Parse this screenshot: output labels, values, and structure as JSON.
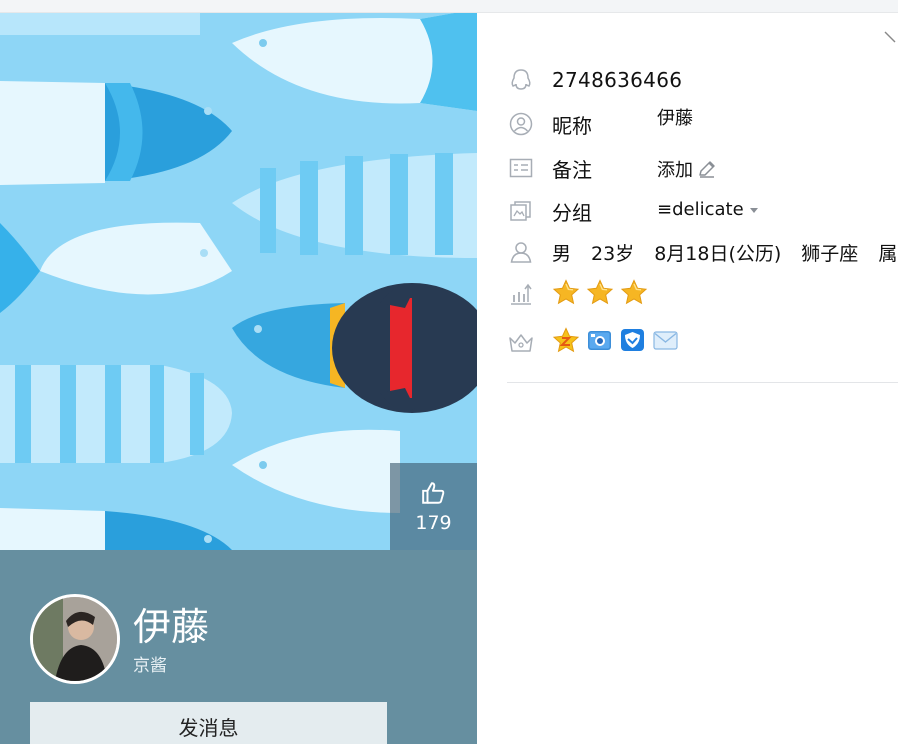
{
  "profile": {
    "like_count": "179",
    "display_name": "伊藤",
    "sub_name": "京酱",
    "send_message_label": "发消息"
  },
  "details": {
    "qq_number": "2748636466",
    "nickname_label": "昵称",
    "nickname_value": "伊藤",
    "remark_label": "备注",
    "remark_action": "添加",
    "group_label": "分组",
    "group_value": "≡delicate",
    "gender": "男",
    "age": "23岁",
    "birthday": "8月18日(公历)",
    "zodiac": "狮子座",
    "truncated": "属",
    "level_star_count": 3
  },
  "icons": {
    "qq": "qq-penguin-icon",
    "nickname": "user-circle-icon",
    "remark": "card-icon",
    "group": "group-icon",
    "basic": "person-icon",
    "level": "level-chart-icon",
    "vip": "crown-icon",
    "like": "thumbs-up-icon"
  },
  "colors": {
    "cover_bg": "#8ed6f6",
    "band": "#668fa0",
    "star": "#f6b623"
  }
}
